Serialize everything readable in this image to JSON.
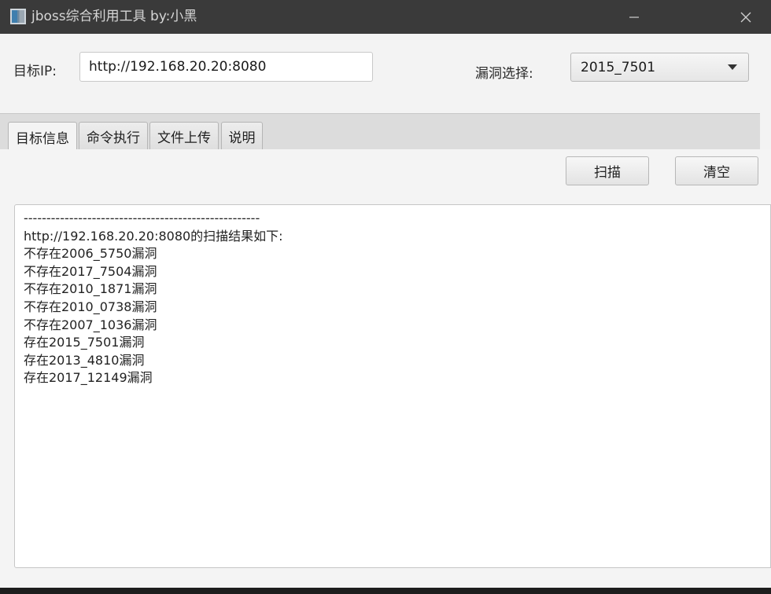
{
  "window": {
    "title": "jboss综合利用工具  by:小黑"
  },
  "form": {
    "ip_label": "目标IP:",
    "ip_value": "http://192.168.20.20:8080",
    "vuln_label": "漏洞选择:",
    "vuln_selected": "2015_7501"
  },
  "tabs": [
    {
      "label": "目标信息",
      "active": true
    },
    {
      "label": "命令执行",
      "active": false
    },
    {
      "label": "文件上传",
      "active": false
    },
    {
      "label": "说明",
      "active": false
    }
  ],
  "toolbar": {
    "scan_label": "扫描",
    "clear_label": "清空"
  },
  "output": {
    "lines": [
      "----------------------------------------------------",
      "http://192.168.20.20:8080的扫描结果如下:",
      "不存在2006_5750漏洞",
      "不存在2017_7504漏洞",
      "不存在2010_1871漏洞",
      "不存在2010_0738漏洞",
      "不存在2007_1036漏洞",
      "存在2015_7501漏洞",
      "存在2013_4810漏洞",
      "存在2017_12149漏洞"
    ]
  },
  "icons": {
    "app": "app-icon",
    "minimize": "minimize-icon",
    "close": "close-icon",
    "dropdown": "chevron-down-icon"
  },
  "colors": {
    "titlebar": "#3a3a3a",
    "window_bg": "#f3f3f3",
    "tab_strip": "#dcdcdc",
    "output_bg": "#ffffff"
  }
}
